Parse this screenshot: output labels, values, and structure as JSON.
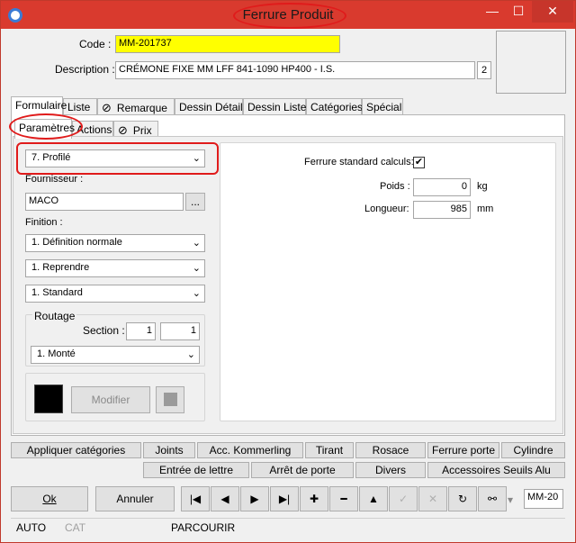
{
  "window": {
    "title": "Ferrure Produit",
    "controls": {
      "minimize": "—",
      "maximize": "☐",
      "close": "✕"
    }
  },
  "header": {
    "code_label": "Code :",
    "code_value": "MM-201737",
    "description_label": "Description :",
    "description_value": "CRÉMONE FIXE  MM LFF 841-1090 HP400 - I.S.",
    "description_count": "2"
  },
  "main_tabs": [
    "Formulaire",
    "Liste",
    "Remarque",
    "Dessin Détail",
    "Dessin Liste",
    "Catégories",
    "Spécial"
  ],
  "sub_tabs": [
    "Paramètres",
    "Actions",
    "Prix"
  ],
  "params": {
    "type_value": "7.  Profilé",
    "fournisseur_label": "Fournisseur :",
    "fournisseur_value": "MACO",
    "browse_label": "...",
    "finition_label": "Finition :",
    "finition_1": "1.  Définition normale",
    "finition_2": "1.  Reprendre",
    "finition_3": "1.  Standard",
    "routage_label": "Routage",
    "section_label": "Section :",
    "section_1": "1",
    "section_2": "1",
    "routage_value": "1.  Monté",
    "modifier_label": "Modifier"
  },
  "right": {
    "ferrure_calc_label": "Ferrure standard calculs:",
    "ferrure_calc_checked": "✔",
    "poids_label": "Poids :",
    "poids_value": "0",
    "poids_unit": "kg",
    "longueur_label": "Longueur:",
    "longueur_value": "985",
    "longueur_unit": "mm"
  },
  "button_row_1": [
    "Appliquer catégories",
    "Joints",
    "Acc. Kommerling",
    "Tirant",
    "Rosace",
    "Ferrure porte",
    "Cylindre"
  ],
  "button_row_2": [
    "Entrée de lettre",
    "Arrêt de porte",
    "Divers",
    "Accessoires Seuils Alu"
  ],
  "bottom": {
    "ok_label": "Ok",
    "cancel_label": "Annuler",
    "nav_first": "|◀",
    "nav_prev": "◀",
    "nav_next": "▶",
    "nav_last": "▶|",
    "add": "✚",
    "remove": "━",
    "up": "▲",
    "confirm": "✓",
    "cancel_x": "✕",
    "refresh": "↻",
    "find": "⚯",
    "dropdown": "▾",
    "record_value": "MM-20"
  },
  "status": [
    "AUTO",
    "CAT",
    "PARCOURIR"
  ]
}
